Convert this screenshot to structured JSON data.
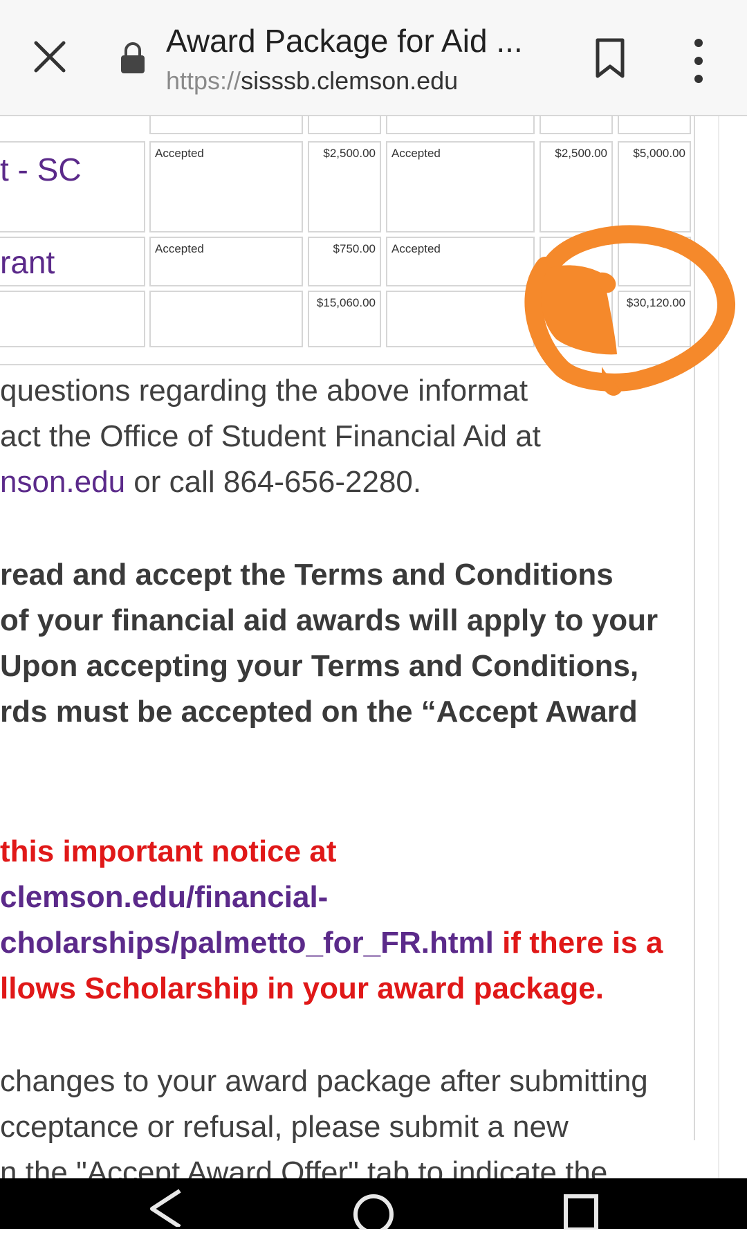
{
  "browser": {
    "title": "Award Package for Aid ...",
    "url_scheme": "https://",
    "url_host": "sisssb.clemson.edu"
  },
  "table": {
    "rows": [
      {
        "name": "t - SC",
        "status1": "Accepted",
        "amount1": "$2,500.00",
        "status2": "Accepted",
        "amount2": "$2,500.00",
        "total": "$5,000.00"
      },
      {
        "name": "rant",
        "status1": "Accepted",
        "amount1": "$750.00",
        "status2": "Accepted"
      },
      {
        "name": "",
        "amount1": "$15,060.00",
        "total": "$30,120.00"
      }
    ]
  },
  "contact": {
    "line1": "questions regarding the above informat",
    "line2": "act the Office of Student Financial Aid at",
    "link": "nson.edu",
    "line3_rest": " or call 864-656-2280."
  },
  "terms": {
    "lines": [
      " read and accept the Terms and Conditions",
      "of your financial aid awards will apply to your",
      " Upon accepting your Terms and Conditions,",
      "rds must be accepted on the “Accept Award"
    ]
  },
  "notice": {
    "line1": " this important notice at",
    "link1": "clemson.edu/financial-",
    "link2": "cholarships/palmetto_for_FR.html",
    "line3_rest": " if there is a",
    "line4": "llows Scholarship in your award package."
  },
  "changes": {
    "lines": [
      "changes to your award package after submitting",
      "cceptance or refusal, please submit a new",
      "n the \"Accept Award Offer\" tab to indicate the"
    ]
  },
  "colors": {
    "annotation": "#f5892b",
    "link": "#5b2a8a",
    "notice": "#e01818"
  }
}
